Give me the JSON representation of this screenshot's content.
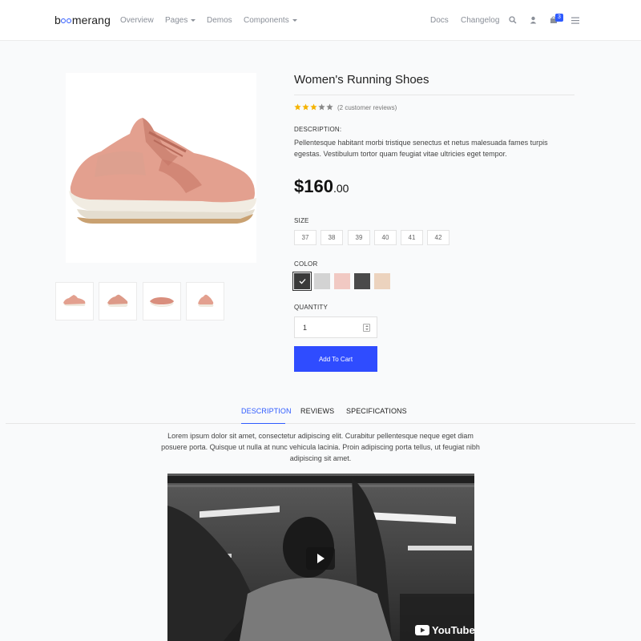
{
  "brand": {
    "name_start": "b",
    "name_end": "merang"
  },
  "nav": {
    "left": [
      "Overview",
      "Pages",
      "Demos",
      "Components"
    ],
    "right": [
      "Docs",
      "Changelog"
    ],
    "cart_count": "3"
  },
  "product": {
    "title": "Women's Running Shoes",
    "rating": 3,
    "rating_max": 5,
    "reviews_text": "(2 customer reviews)",
    "description_label": "DESCRIPTION:",
    "description": "Pellentesque habitant morbi tristique senectus et netus malesuada fames turpis egestas. Vestibulum tortor quam feugiat vitae ultricies eget tempor.",
    "price_main": "$160",
    "price_cents": ".00",
    "size_label": "SIZE",
    "sizes": [
      "37",
      "38",
      "39",
      "40",
      "41",
      "42"
    ],
    "color_label": "COLOR",
    "colors": [
      "#3a3a3a",
      "#d3d3d3",
      "#f1c9c3",
      "#4a4a4a",
      "#ecd3be"
    ],
    "selected_color_index": 0,
    "quantity_label": "QUANTITY",
    "quantity": "1",
    "add_to_cart": "Add To Cart"
  },
  "tabs": {
    "items": [
      "DESCRIPTION",
      "REVIEWS",
      "SPECIFICATIONS"
    ],
    "active": "DESCRIPTION",
    "content": "Lorem ipsum dolor sit amet, consectetur adipiscing elit. Curabitur pellentesque neque eget diam posuere porta. Quisque ut nulla at nunc vehicula lacinia. Proin adipiscing porta tellus, ut feugiat nibh adipiscing sit amet."
  },
  "video": {
    "logo_text": "YouTube"
  },
  "colors": {
    "accent": "#2f5bff",
    "star": "#f5b301"
  }
}
